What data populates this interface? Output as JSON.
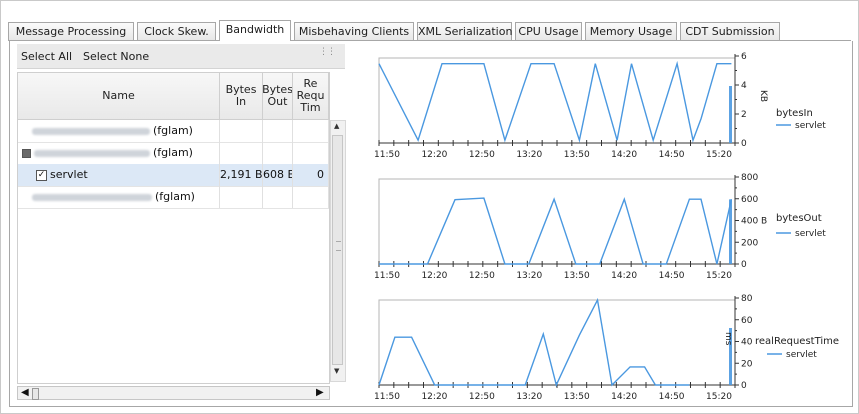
{
  "tabs": [
    {
      "label": "Message Processing",
      "active": false
    },
    {
      "label": "Clock Skew.",
      "active": false
    },
    {
      "label": "Bandwidth",
      "active": true
    },
    {
      "label": "Misbehaving Clients",
      "active": false
    },
    {
      "label": "XML Serialization",
      "active": false
    },
    {
      "label": "CPU Usage",
      "active": false
    },
    {
      "label": "Memory Usage",
      "active": false
    },
    {
      "label": "CDT Submission",
      "active": false
    }
  ],
  "selection": {
    "select_all": "Select All",
    "select_none": "Select None"
  },
  "table": {
    "columns": [
      "Name",
      "Bytes In",
      "Bytes Out",
      "Re Requ Tim"
    ],
    "rows": [
      {
        "name": "(fglam)",
        "bytes_in": "",
        "bytes_out": "",
        "req": ""
      },
      {
        "name": "(fglam)",
        "bytes_in": "",
        "bytes_out": "",
        "req": ""
      },
      {
        "name": "servlet",
        "bytes_in": "2,191 B",
        "bytes_out": "608 B",
        "req": "0"
      },
      {
        "name": "(fglam)",
        "bytes_in": "",
        "bytes_out": "",
        "req": ""
      }
    ]
  },
  "line_color": "#4a98e0",
  "chart_data": [
    {
      "type": "line",
      "title": "bytesIn",
      "ylabel": "KB",
      "ylim": [
        0,
        6
      ],
      "y_ticks": [
        "0",
        "2",
        "4",
        "6"
      ],
      "x_ticks": [
        "11:50",
        "12:20",
        "12:50",
        "13:20",
        "13:50",
        "14:20",
        "14:50",
        "15:20"
      ],
      "series": [
        {
          "name": "servlet",
          "x": [
            11.33,
            11.87,
            12.2,
            12.78,
            13.07,
            13.43,
            13.75,
            14.1,
            14.32,
            14.62,
            14.82,
            15.12,
            15.45,
            15.67,
            15.78
          ],
          "y": [
            5.6,
            0.2,
            5.6,
            5.6,
            0.2,
            5.6,
            5.6,
            0.2,
            5.6,
            0.2,
            5.6,
            0.2,
            5.6,
            0.2,
            1.7
          ]
        },
        {
          "name": "",
          "x": [
            15.78,
            16.0,
            16.2
          ],
          "y": [
            1.7,
            5.6,
            5.6
          ]
        }
      ]
    },
    {
      "type": "line",
      "title": "bytesOut",
      "ylabel": "B",
      "ylim": [
        0,
        800
      ],
      "y_ticks": [
        "0",
        "200",
        "400 B",
        "600",
        "800"
      ],
      "x_ticks": [
        "11:50",
        "12:20",
        "12:50",
        "13:20",
        "13:50",
        "14:20",
        "14:50",
        "15:20"
      ],
      "series": [
        {
          "name": "servlet",
          "x": [
            11.33,
            12.0,
            12.38,
            12.78,
            13.07,
            13.4,
            13.75,
            14.05,
            14.38,
            14.72,
            14.98,
            15.3,
            15.62,
            15.78,
            16.0,
            16.2
          ],
          "y": [
            0,
            0,
            605,
            620,
            0,
            0,
            610,
            0,
            0,
            610,
            0,
            0,
            610,
            610,
            0,
            610
          ]
        }
      ]
    },
    {
      "type": "line",
      "title": "realRequestTime",
      "ylabel": "ms",
      "ylim": [
        0,
        80
      ],
      "y_ticks": [
        "0",
        "20",
        "40",
        "60",
        "80"
      ],
      "x_ticks": [
        "11:50",
        "12:20",
        "12:50",
        "13:20",
        "13:50",
        "14:20",
        "14:50",
        "15:20"
      ],
      "series": [
        {
          "name": "servlet",
          "x": [
            11.33,
            11.55,
            11.78,
            12.1,
            12.4,
            12.78,
            13.05,
            13.35,
            13.6,
            13.78,
            14.1,
            14.35,
            14.55,
            14.8,
            15.0,
            15.15,
            15.32,
            15.5,
            15.62
          ],
          "y": [
            0,
            45,
            45,
            0,
            0,
            0,
            0,
            0,
            48,
            0,
            47,
            80,
            0,
            17,
            17,
            0,
            0,
            0,
            0
          ]
        }
      ]
    }
  ]
}
